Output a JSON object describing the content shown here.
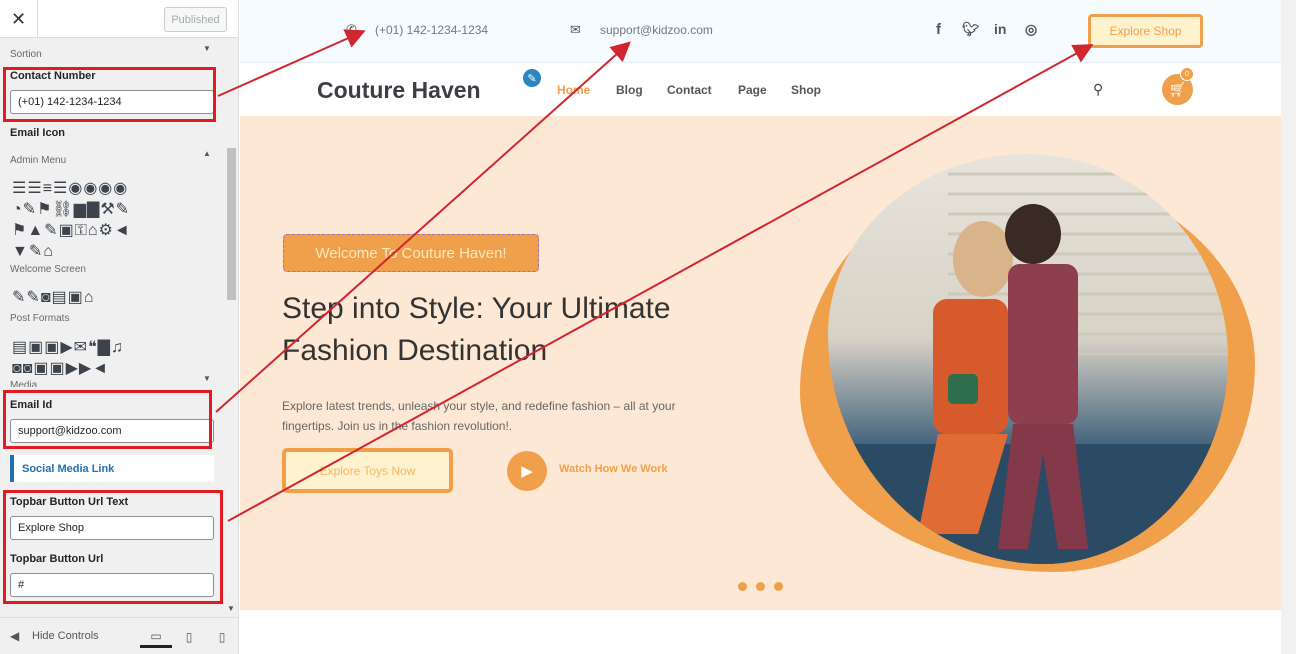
{
  "customizer": {
    "close_icon": "✕",
    "publish_label": "Published",
    "section_label": "Sortion",
    "contact_label": "Contact Number",
    "contact_value": "(+01) 142-1234-1234",
    "email_icon_label": "Email Icon",
    "icon_groups": {
      "admin_menu": "Admin Menu",
      "welcome_screen": "Welcome Screen",
      "post_formats": "Post Formats",
      "media": "Media"
    },
    "email_label": "Email Id",
    "email_value": "support@kidzoo.com",
    "social_label": "Social Media Link",
    "topbar_text_label": "Topbar Button Url Text",
    "topbar_text_value": "Explore Shop",
    "topbar_url_label": "Topbar Button Url",
    "topbar_url_value": "#",
    "hide_controls": "Hide Controls"
  },
  "site": {
    "phone": "(+01) 142-1234-1234",
    "email": "support@kidzoo.com",
    "shop_button": "Explore Shop",
    "brand": "Couture Haven",
    "menu": [
      "Home",
      "Blog",
      "Contact",
      "Page",
      "Shop"
    ],
    "cart_count": "0",
    "welcome": "Welcome To Couture Haven!",
    "heading": "Step into Style: Your Ultimate Fashion Destination",
    "subtext": "Explore latest trends, unleash your style, and redefine fashion – all at your fingertips. Join us in the fashion revolution!.",
    "cta": "Explore Toys Now",
    "watch": "Watch How We Work"
  },
  "colors": {
    "accent": "#f0a04b",
    "annotation": "#d0262e",
    "hero_bg": "#fde8d6",
    "wp_blue": "#2271b1"
  }
}
